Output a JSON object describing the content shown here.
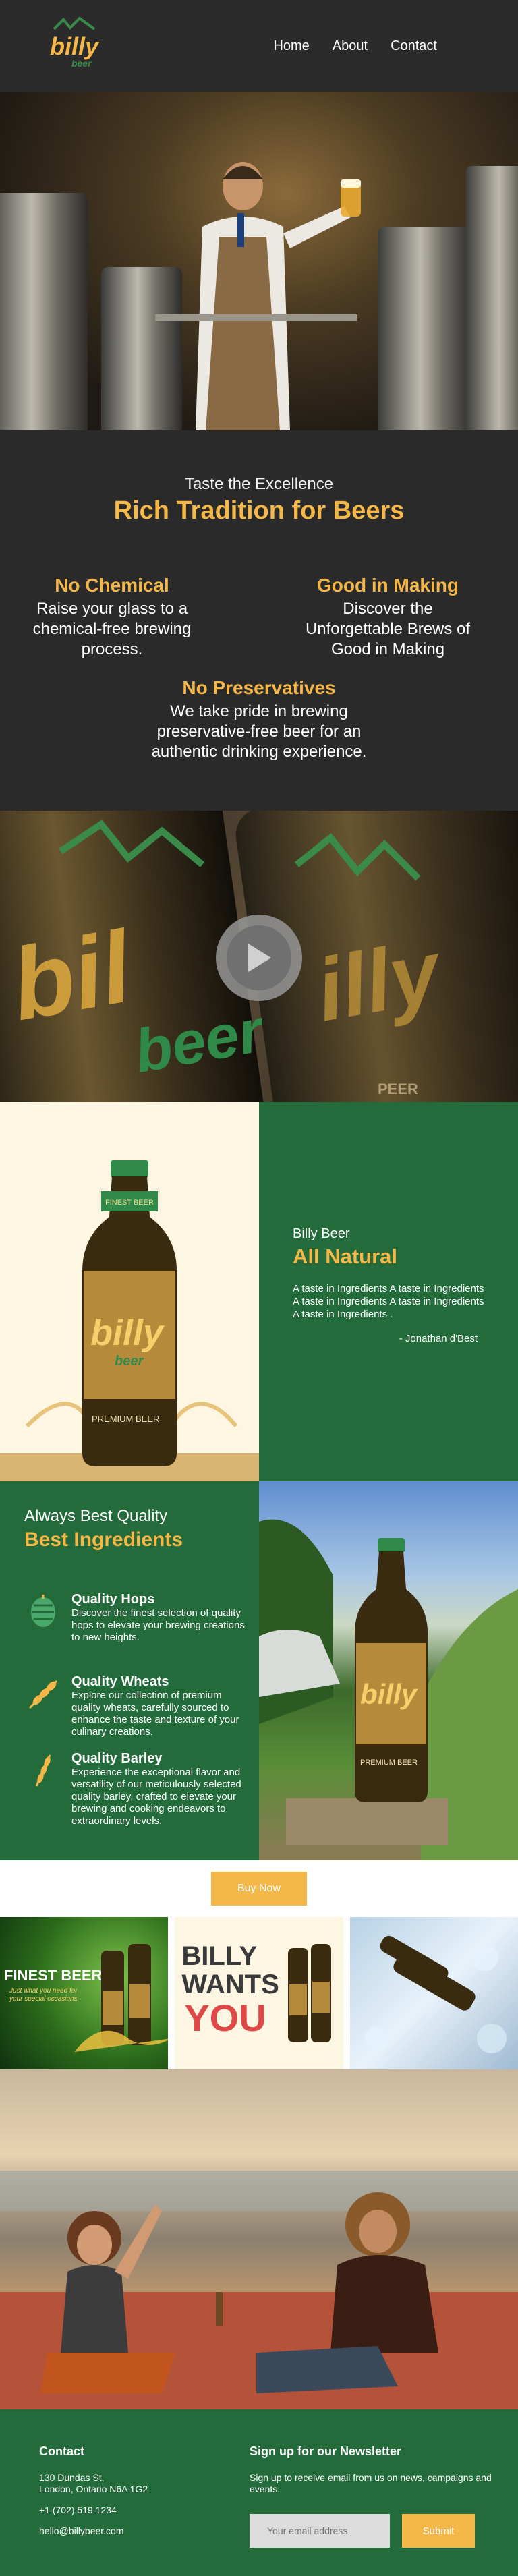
{
  "header": {
    "logo_text": "billy",
    "logo_sub": "beer",
    "nav": [
      "Home",
      "About",
      "Contact"
    ]
  },
  "intro": {
    "subtitle": "Taste the Excellence",
    "title": "Rich Tradition for Beers",
    "features": [
      {
        "title": "No Chemical",
        "text": "Raise your glass to a chemical-free brewing process."
      },
      {
        "title": "Good in Making",
        "text": "Discover the Unforgettable Brews of Good in Making"
      },
      {
        "title": "No Preservatives",
        "text": "We take pride in brewing preservative-free beer for an authentic drinking experience."
      }
    ]
  },
  "natural": {
    "brand": "Billy Beer",
    "title": "All Natural",
    "description": "A taste in Ingredients A taste in Ingredients A taste in Ingredients A taste in Ingredients A  taste in Ingredients .",
    "author": "- Jonathan d'Best",
    "bottle_label": "PREMIUM BEER"
  },
  "quality": {
    "subtitle": "Always Best Quality",
    "title": "Best Ingredients",
    "items": [
      {
        "title": "Quality Hops",
        "text": "Discover the finest selection of quality hops to elevate your brewing creations to new heights.",
        "icon": "hop-icon"
      },
      {
        "title": "Quality Wheats",
        "text": "Explore our collection of premium quality wheats, carefully sourced to enhance the taste and texture of your culinary creations.",
        "icon": "wheat-icon"
      },
      {
        "title": "Quality Barley",
        "text": "Experience the exceptional flavor and versatility of our meticulously selected quality barley, crafted to elevate your brewing and cooking endeavors to extraordinary levels.",
        "icon": "barley-icon"
      }
    ]
  },
  "buy": {
    "label": "Buy Now"
  },
  "gallery": {
    "g1_title": "FINEST BEER !",
    "g1_sub": "Just what you need for your special occasions",
    "g2_line1": "BILLY",
    "g2_line2": "WANTS",
    "g2_line3": "YOU"
  },
  "footer": {
    "contact_title": "Contact",
    "address1": "130 Dundas St,",
    "address2": "London, Ontario N6A 1G2",
    "phone": "+1 (702) 519 1234",
    "email": "hello@billybeer.com",
    "newsletter_title": "Sign up for our Newsletter",
    "newsletter_text": "Sign up to receive email from us on news, campaigns and events.",
    "email_placeholder": "Your email address",
    "submit_label": "Submit"
  },
  "colors": {
    "accent": "#f5b748",
    "green": "#246b3b",
    "dark": "#2a2a2a",
    "cream": "#fcf6e2"
  }
}
